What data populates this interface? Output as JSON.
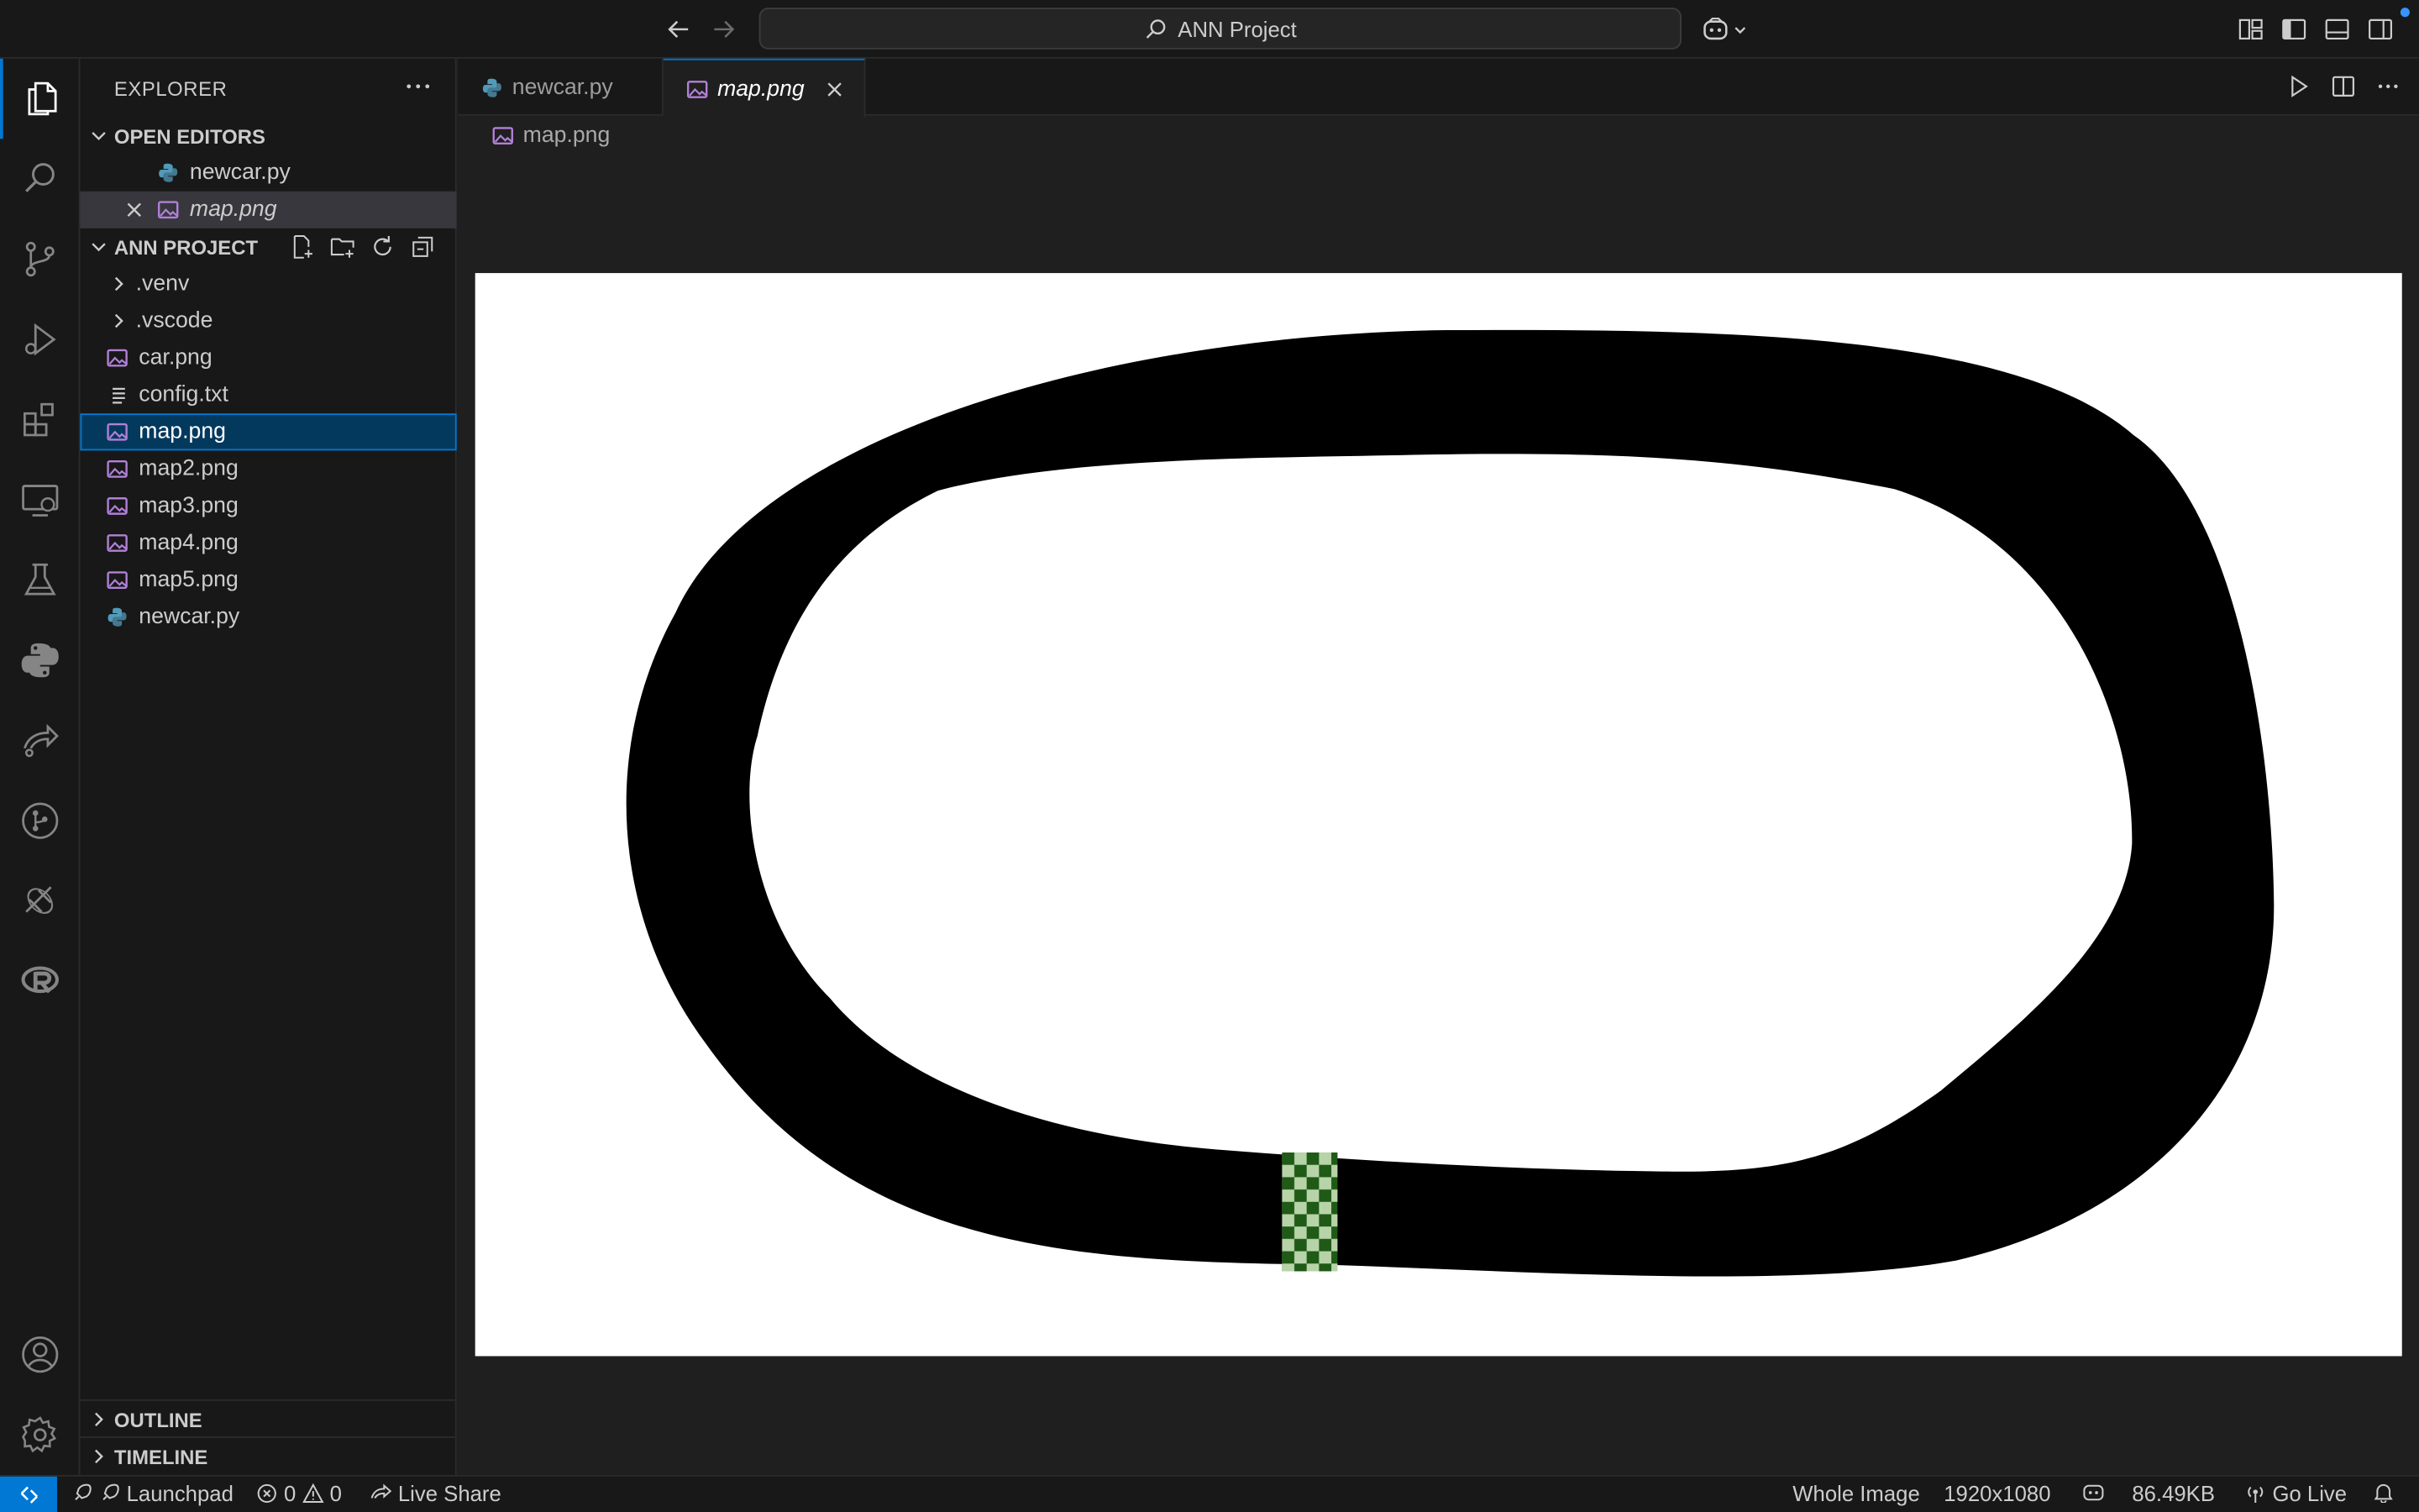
{
  "titlebar": {
    "search_text": "ANN Project"
  },
  "activity_bar": {
    "items": [
      "explorer-icon",
      "search-icon",
      "source-control-icon",
      "run-debug-icon",
      "extensions-icon",
      "remote-explorer-icon",
      "testing-icon",
      "python-icon",
      "live-share-icon",
      "git-graph-icon",
      "docker-icon",
      "r-icon"
    ],
    "bottom": [
      "accounts-icon",
      "settings-gear-icon"
    ]
  },
  "sidebar": {
    "title": "EXPLORER",
    "open_editors": {
      "label": "OPEN EDITORS",
      "items": [
        {
          "name": "newcar.py",
          "type": "python"
        },
        {
          "name": "map.png",
          "type": "image"
        }
      ]
    },
    "project": {
      "label": "ANN PROJECT",
      "items": [
        {
          "name": ".venv",
          "type": "folder"
        },
        {
          "name": ".vscode",
          "type": "folder"
        },
        {
          "name": "car.png",
          "type": "image"
        },
        {
          "name": "config.txt",
          "type": "text"
        },
        {
          "name": "map.png",
          "type": "image"
        },
        {
          "name": "map2.png",
          "type": "image"
        },
        {
          "name": "map3.png",
          "type": "image"
        },
        {
          "name": "map4.png",
          "type": "image"
        },
        {
          "name": "map5.png",
          "type": "image"
        },
        {
          "name": "newcar.py",
          "type": "python"
        }
      ]
    },
    "outline_label": "OUTLINE",
    "timeline_label": "TIMELINE"
  },
  "tabs": [
    {
      "label": "newcar.py",
      "active": false
    },
    {
      "label": "map.png",
      "active": true
    }
  ],
  "breadcrumb": "map.png",
  "statusbar": {
    "launchpad": "Launchpad",
    "errors": "0",
    "warnings": "0",
    "live_share": "Live Share",
    "zoom": "Whole Image",
    "dimensions": "1920x1080",
    "size": "86.49KB",
    "go_live": "Go Live"
  },
  "colors": {
    "accent": "#0078d4",
    "image_icon": "#b180d7",
    "python_icon": "#519aba"
  }
}
